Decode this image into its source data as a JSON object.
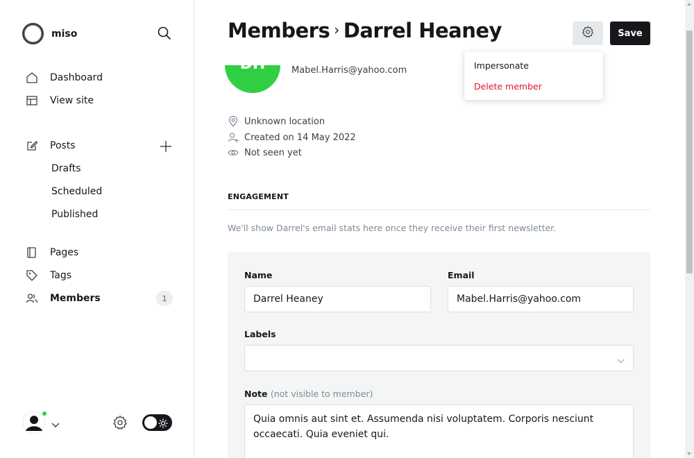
{
  "sidebar": {
    "brand": "miso",
    "nav": {
      "dashboard": "Dashboard",
      "view_site": "View site",
      "posts": "Posts",
      "drafts": "Drafts",
      "scheduled": "Scheduled",
      "published": "Published",
      "pages": "Pages",
      "tags": "Tags",
      "members": "Members",
      "members_count": "1"
    }
  },
  "header": {
    "breadcrumb_parent": "Members",
    "breadcrumb_sep": "›",
    "member_name": "Darrel Heaney",
    "save_label": "Save"
  },
  "member": {
    "initials": "DH",
    "email": "Mabel.Harris@yahoo.com",
    "location": "Unknown location",
    "created": "Created on 14 May 2022",
    "last_seen": "Not seen yet"
  },
  "engagement": {
    "heading": "ENGAGEMENT",
    "note": "We'll show Darrel's email stats here once they receive their first newsletter."
  },
  "form": {
    "name_label": "Name",
    "name_value": "Darrel Heaney",
    "email_label": "Email",
    "email_value": "Mabel.Harris@yahoo.com",
    "labels_label": "Labels",
    "note_label": "Note",
    "note_hint": "(not visible to member)",
    "note_value": "Quia omnis aut sint et. Assumenda nisi voluptatem. Corporis nesciunt occaecati. Quia eveniet qui."
  },
  "dropdown": {
    "impersonate": "Impersonate",
    "delete_member": "Delete member"
  },
  "colors": {
    "accent_green": "#30cf43",
    "danger": "#e0152e",
    "dark": "#15171a"
  }
}
